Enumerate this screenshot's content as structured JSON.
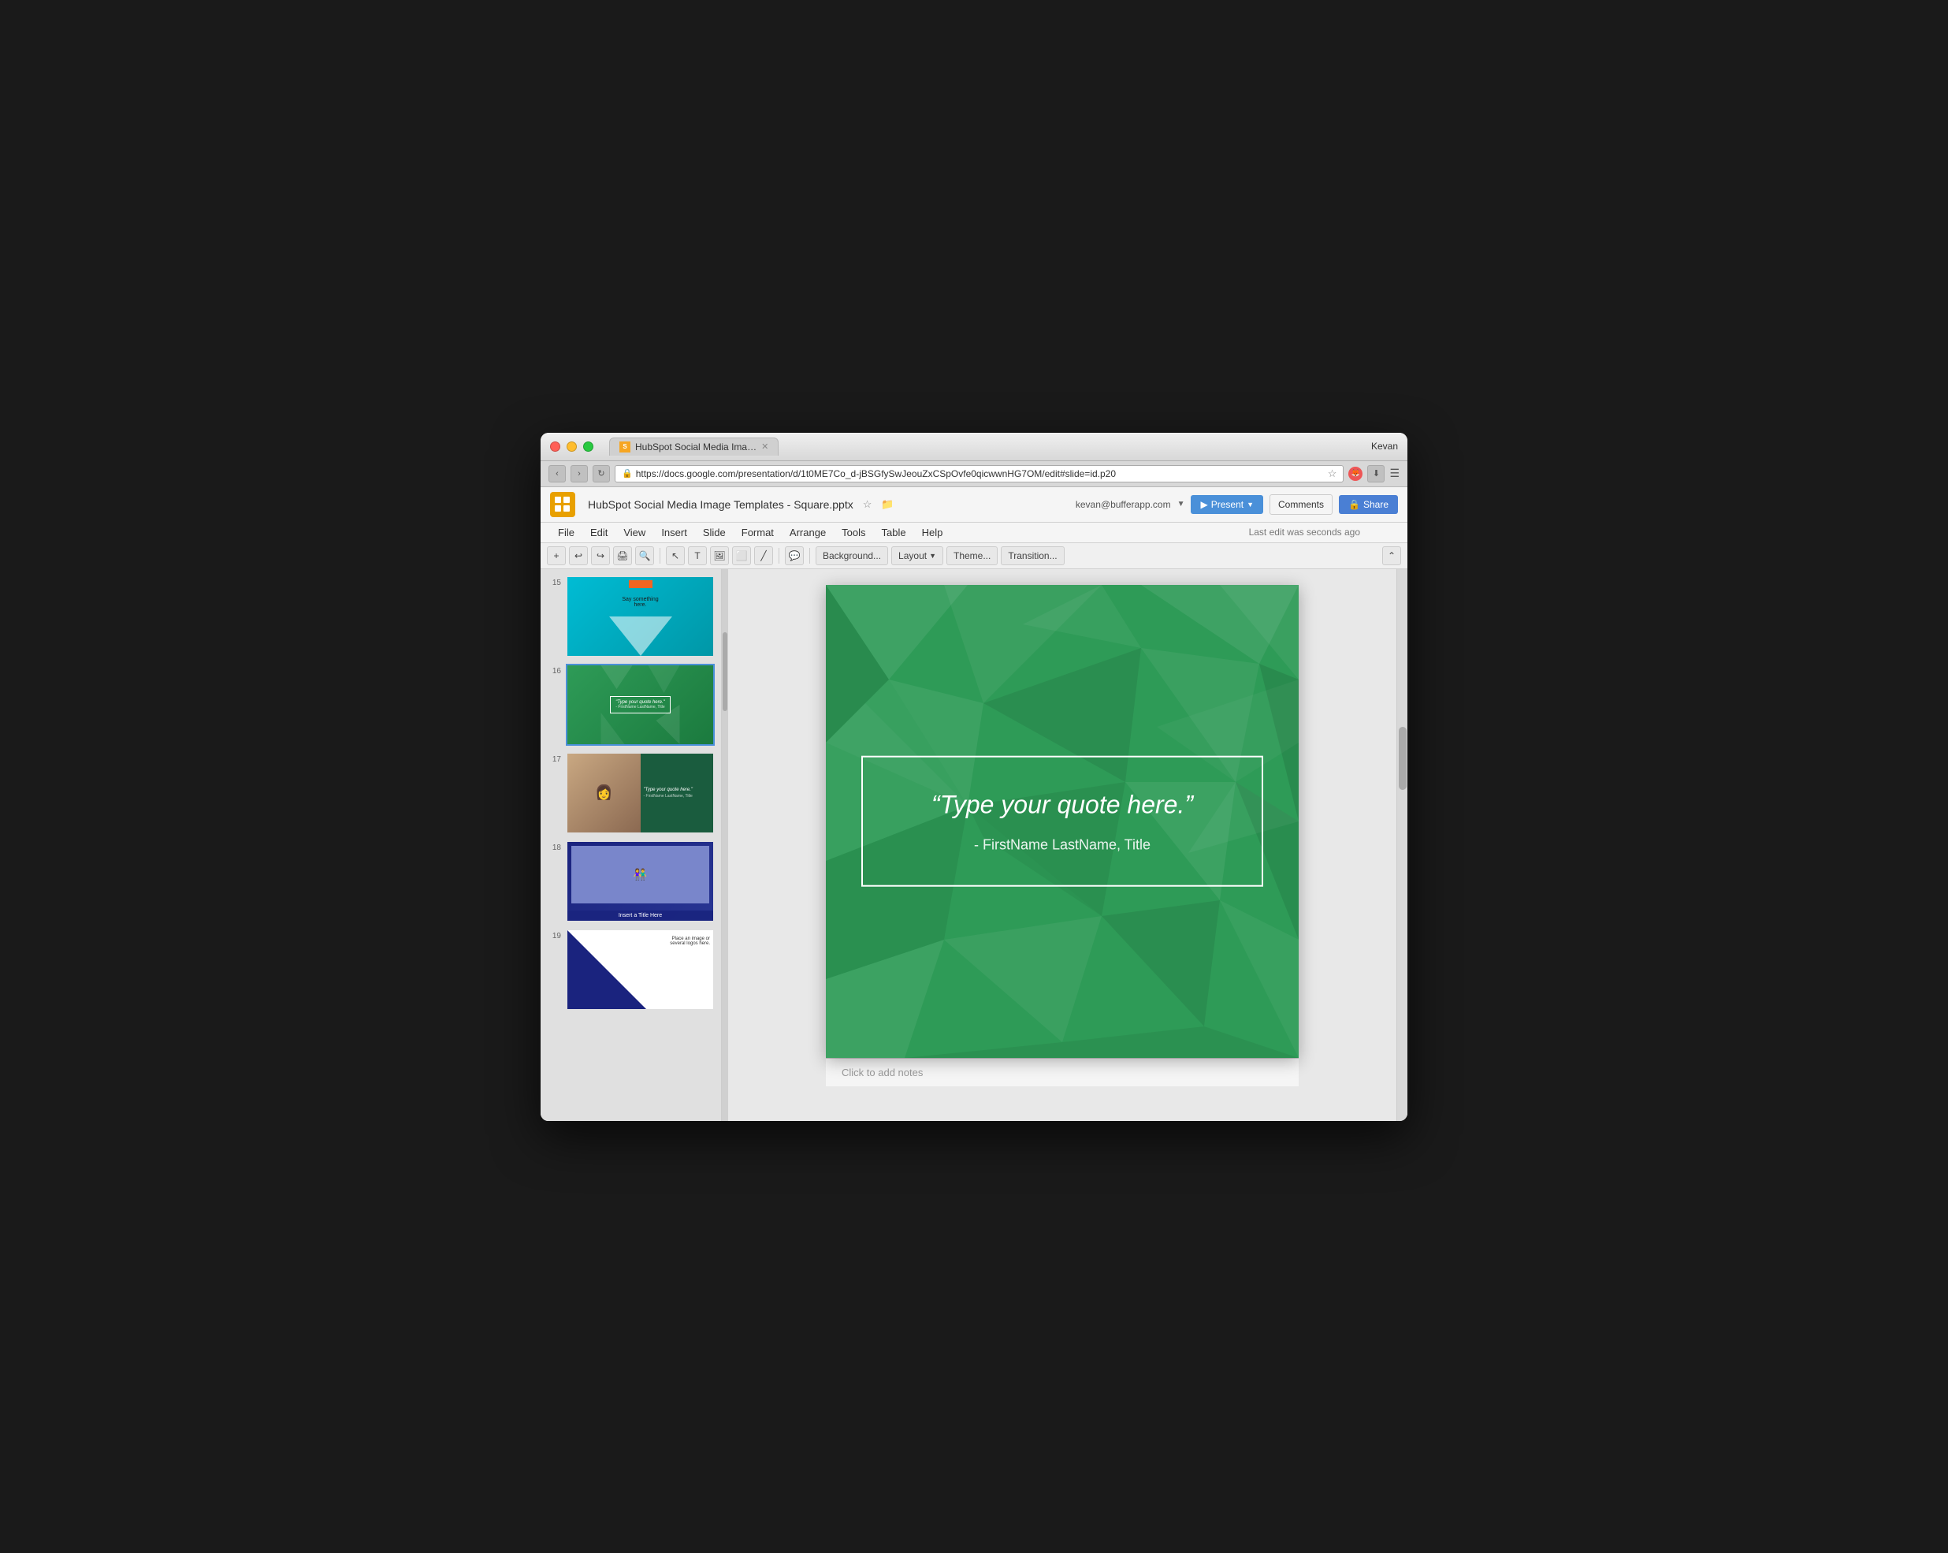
{
  "window": {
    "user": "Kevan"
  },
  "tab": {
    "title": "HubSpot Social Media Ima…",
    "favicon": "S"
  },
  "address_bar": {
    "url": "https://docs.google.com/presentation/d/1t0ME7Co_d-jBSGfySwJeouZxCSpOvfe0qicwwnHG7OM/edit#slide=id.p20",
    "back": "‹",
    "forward": "›",
    "refresh": "↻"
  },
  "app": {
    "logo": "S",
    "title": "HubSpot Social Media Image Templates - Square.pptx",
    "account": "kevan@bufferapp.com",
    "present_label": "Present",
    "comments_label": "Comments",
    "share_label": "Share"
  },
  "menu": {
    "items": [
      "File",
      "Edit",
      "View",
      "Insert",
      "Slide",
      "Format",
      "Arrange",
      "Tools",
      "Table",
      "Help"
    ],
    "last_edit": "Last edit was seconds ago"
  },
  "slide": {
    "number": "16",
    "quote_text": "“Type your quote here.”",
    "quote_attr": "- FirstName LastName, Title",
    "notes_placeholder": "Click to add notes"
  },
  "thumbnails": [
    {
      "num": "15",
      "type": "teal-triangle",
      "text": "Say something here ."
    },
    {
      "num": "16",
      "type": "green-quote",
      "active": true,
      "quote": "\"Type your quote here.\"",
      "attr": "- FirstName LastName, Title"
    },
    {
      "num": "17",
      "type": "photo-quote",
      "quote": "\"Type your quote here.\"",
      "attr": "- FirstName LastName, Title"
    },
    {
      "num": "18",
      "type": "photo-title",
      "title": "Insert a Title Here"
    },
    {
      "num": "19",
      "type": "triangle-text",
      "text": "Place an image or several logos here."
    }
  ],
  "toolbar": {
    "background_label": "Background...",
    "layout_label": "Layout",
    "theme_label": "Theme...",
    "transition_label": "Transition..."
  }
}
